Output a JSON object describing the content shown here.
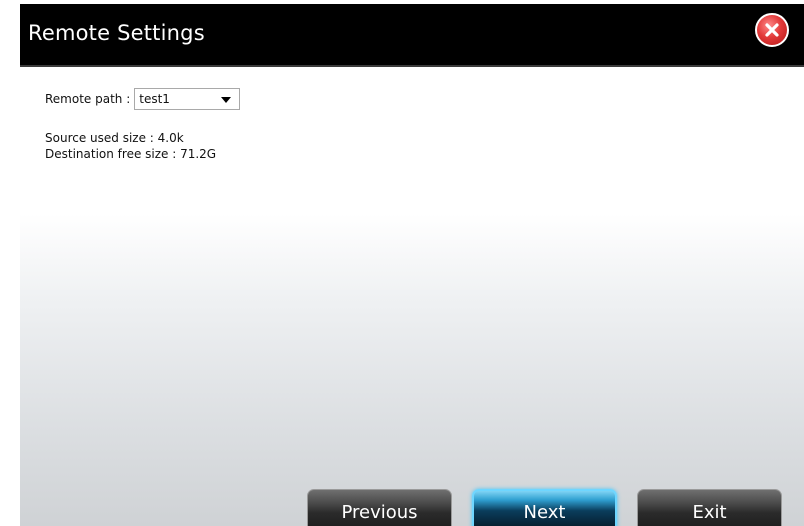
{
  "dialog": {
    "title": "Remote Settings",
    "close_icon": "close-icon"
  },
  "form": {
    "remote_path_label": "Remote path :",
    "remote_path_value": "test1",
    "source_used_size": "Source used size : 4.0k",
    "destination_free_size": "Destination free size : 71.2G"
  },
  "buttons": {
    "previous": "Previous",
    "next": "Next",
    "exit": "Exit"
  },
  "colors": {
    "title_bar": "#000000",
    "close_button": "#e23a3a",
    "next_button_glow": "#6fd6ff"
  }
}
